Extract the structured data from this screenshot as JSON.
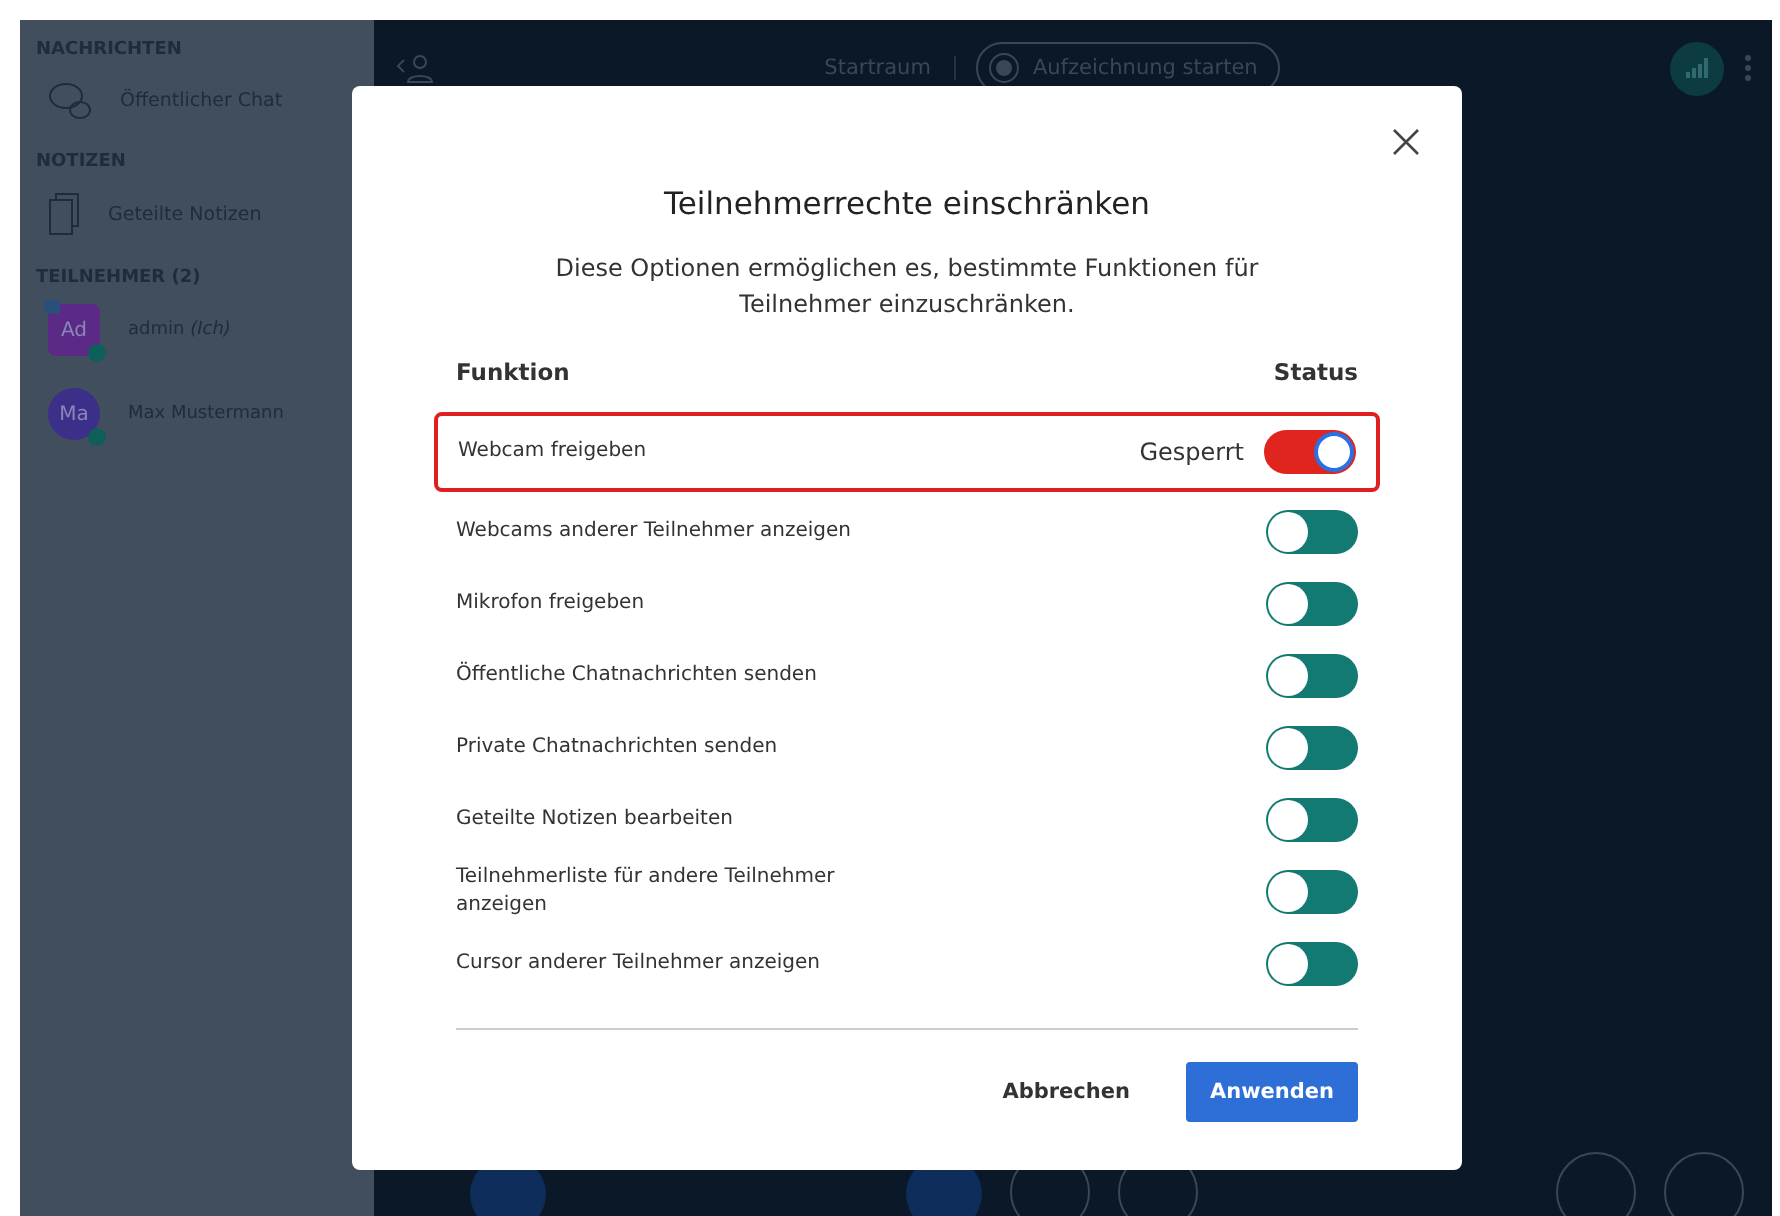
{
  "sidebar": {
    "sections": [
      {
        "title": "NACHRICHTEN",
        "items": [
          {
            "kind": "chat",
            "label": "Öffentlicher Chat"
          }
        ]
      },
      {
        "title": "NOTIZEN",
        "items": [
          {
            "kind": "notes",
            "label": "Geteilte Notizen"
          }
        ]
      },
      {
        "title": "TEILNEHMER (2)",
        "users": [
          {
            "initials": "Ad",
            "name": "admin",
            "suffix": "(Ich)",
            "color": "#5b2a86",
            "presenter": true
          },
          {
            "initials": "Ma",
            "name": "Max Mustermann",
            "color": "#3b2f8a",
            "presenter": false
          }
        ]
      }
    ]
  },
  "topbar": {
    "room": "Startraum",
    "record_label": "Aufzeichnung starten"
  },
  "dialog": {
    "title": "Teilnehmerrechte einschränken",
    "description": "Diese Optionen ermöglichen es, bestimmte Funktionen für Teilnehmer einzuschränken.",
    "column_1": "Funktion",
    "column_2": "Status",
    "rows": [
      {
        "label": "Webcam freigeben",
        "locked": true,
        "status": "Gesperrt",
        "highlighted": true
      },
      {
        "label": "Webcams anderer Teilnehmer anzeigen",
        "locked": false,
        "highlighted": false
      },
      {
        "label": "Mikrofon freigeben",
        "locked": false,
        "highlighted": false
      },
      {
        "label": "Öffentliche Chatnachrichten senden",
        "locked": false,
        "highlighted": false
      },
      {
        "label": "Private Chatnachrichten senden",
        "locked": false,
        "highlighted": false
      },
      {
        "label": "Geteilte Notizen bearbeiten",
        "locked": false,
        "highlighted": false
      },
      {
        "label": "Teilnehmerliste für andere Teilnehmer anzeigen",
        "locked": false,
        "highlighted": false
      },
      {
        "label": "Cursor anderer Teilnehmer anzeigen",
        "locked": false,
        "highlighted": false
      }
    ],
    "cancel": "Abbrechen",
    "apply": "Anwenden"
  }
}
